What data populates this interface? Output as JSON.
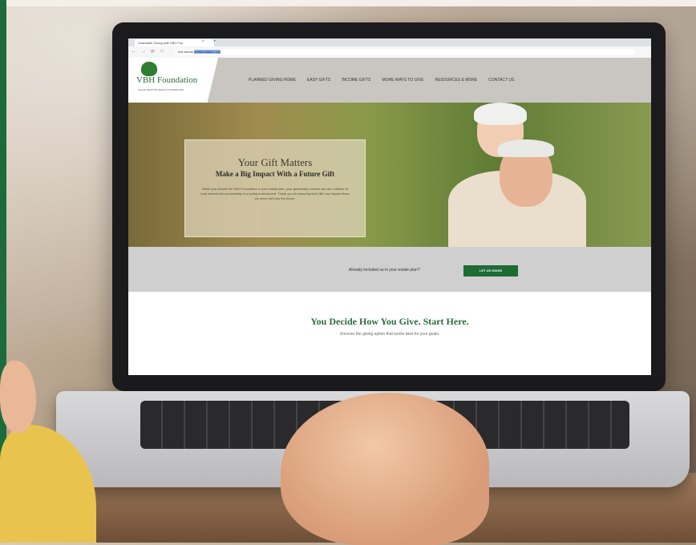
{
  "browser": {
    "tab_title": "Charitable Giving with VBH Fou",
    "tab_close": "×",
    "new_tab": "+",
    "back": "←",
    "forward": "→",
    "reload": "⟳",
    "home": "⌂",
    "url_prefix": "Not secure",
    "url": "vbhfoundation.org"
  },
  "site": {
    "logo_text": "VBH Foundation",
    "logo_tagline": "VALLEY BAPTIST HEALTH FOUNDATION",
    "nav": [
      "PLANNED GIVING HOME",
      "EASY GIFTS",
      "INCOME GIFTS",
      "MORE WAYS TO GIVE",
      "RESOURCES & MORE",
      "CONTACT US"
    ],
    "hero": {
      "title": "Your Gift Matters",
      "subtitle": "Make a Big Impact With a Future Gift",
      "body": "When you include the VBH Foundation in your estate plan, your generosity ensures we can continue to help seniors live successfully in a loving environment. Thank you for ensuring that VBH can impact those we serve well into the future."
    },
    "cta": {
      "text": "Already included us in your estate plan?",
      "button": "LET US KNOW"
    },
    "section": {
      "title": "You Decide How You Give. Start Here.",
      "subtitle": "Uncover the giving option that works best for your goals."
    }
  },
  "colors": {
    "brand_green": "#1e6b34",
    "accent_strip": "#1d6b3a"
  }
}
